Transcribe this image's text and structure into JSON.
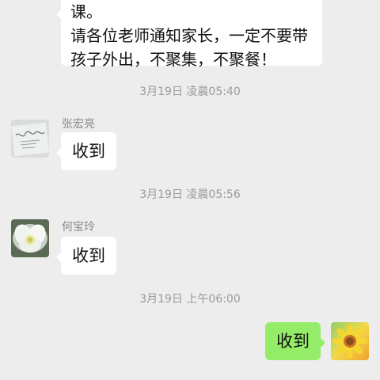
{
  "chat": {
    "top_message": {
      "lines": [
        "课。",
        "请各位老师通知家长，一定不要带",
        "孩子外出，不聚集，不聚餐！"
      ]
    },
    "messages": [
      {
        "time": "3月19日 凌晨05:40",
        "sender": "张宏亮",
        "text": "收到"
      },
      {
        "time": "3月19日 凌晨05:56",
        "sender": "何宝玲",
        "text": "收到"
      },
      {
        "time": "3月19日 上午06:00",
        "sender": "",
        "text": "收到"
      }
    ]
  },
  "colors": {
    "background": "#ededed",
    "incoming_bubble": "#ffffff",
    "outgoing_bubble": "#95ec69",
    "timestamp_text": "#9b9b9b"
  },
  "icons": {
    "avatar_zhang": "handwritten-card-photo",
    "avatar_he": "white-flower-photo",
    "avatar_self": "sunflower-photo"
  }
}
